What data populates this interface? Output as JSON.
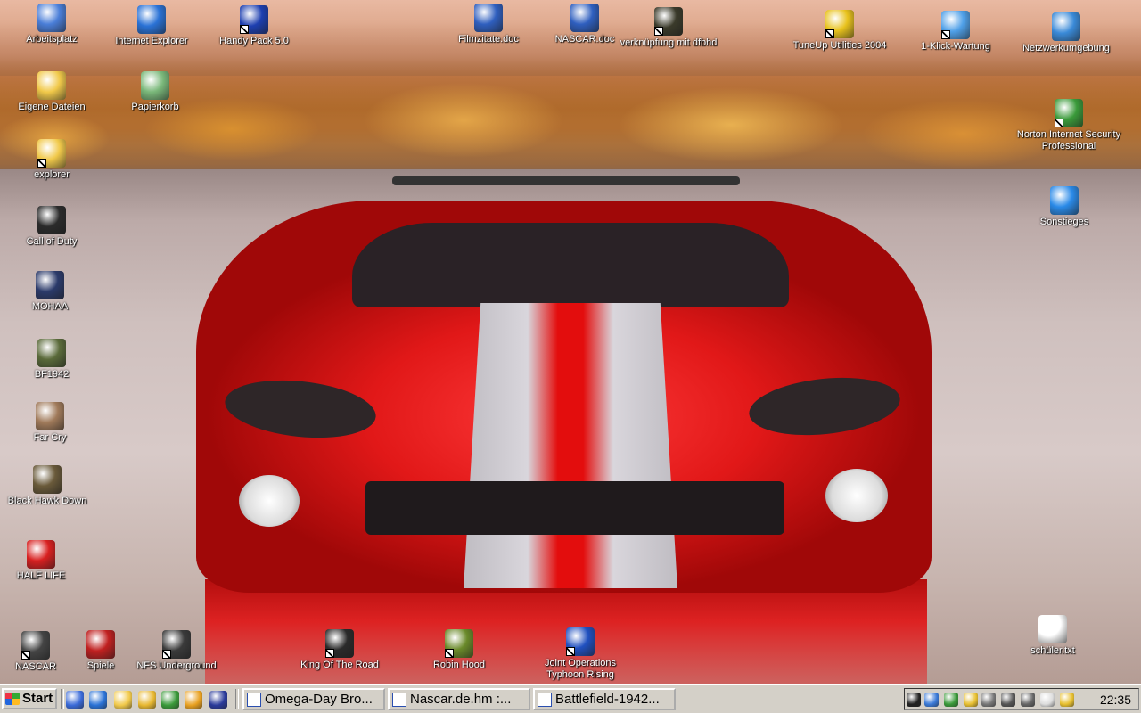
{
  "desktop": {
    "icons": [
      {
        "label": "Arbeitsplatz",
        "icon": "computer-icon",
        "color": "#4a7ed8"
      },
      {
        "label": "Internet Explorer",
        "icon": "internet-explorer-icon",
        "color": "#2a72d6"
      },
      {
        "label": "Handy Pack 5.0",
        "icon": "mobile-phone-icon",
        "color": "#1d3fb0"
      },
      {
        "label": "Filmzitate.doc",
        "icon": "word-document-icon",
        "color": "#2f5fbf"
      },
      {
        "label": "NASCAR.doc",
        "icon": "word-document-icon",
        "color": "#2f5fbf"
      },
      {
        "label": "verknüpfung mit dfbhd",
        "icon": "soldier-icon",
        "color": "#3a3a2a"
      },
      {
        "label": "TuneUp Utilities 2004",
        "icon": "tuneup-icon",
        "color": "#e8c21c"
      },
      {
        "label": "1-Klick-Wartung",
        "icon": "maintenance-icon",
        "color": "#4fa0e8"
      },
      {
        "label": "Netzwerkumgebung",
        "icon": "network-icon",
        "color": "#3a8ad8"
      },
      {
        "label": "Eigene Dateien",
        "icon": "folder-icon",
        "color": "#f1c94a"
      },
      {
        "label": "Papierkorb",
        "icon": "recycle-bin-icon",
        "color": "#7ab87a"
      },
      {
        "label": "Norton Internet Security Professional",
        "icon": "norton-globe-icon",
        "color": "#3a9a3a"
      },
      {
        "label": "explorer",
        "icon": "explorer-folder-icon",
        "color": "#f1c94a"
      },
      {
        "label": "Sonstieges",
        "icon": "butterfly-icon",
        "color": "#2a8ae8"
      },
      {
        "label": "Call of Duty",
        "icon": "call-of-duty-icon",
        "color": "#2b2b2b"
      },
      {
        "label": "MOHAA",
        "icon": "mohaa-emblem-icon",
        "color": "#2b3a6a"
      },
      {
        "label": "BF1942",
        "icon": "battlefield-tank-icon",
        "color": "#5a6a3a"
      },
      {
        "label": "Far Cry",
        "icon": "far-cry-face-icon",
        "color": "#a07a5a"
      },
      {
        "label": "Black Hawk Down",
        "icon": "black-hawk-soldier-icon",
        "color": "#6a5a3a"
      },
      {
        "label": "HALF LIFE",
        "icon": "half-life-lambda-icon",
        "color": "#d82020"
      },
      {
        "label": "NASCAR",
        "icon": "tire-icon",
        "color": "#444444"
      },
      {
        "label": "Spiele",
        "icon": "crest-icon",
        "color": "#c02020"
      },
      {
        "label": "NFS Underground",
        "icon": "wheel-rim-icon",
        "color": "#3a3a3a"
      },
      {
        "label": "King Of The Road",
        "icon": "king-of-the-road-icon",
        "color": "#2a2a2a"
      },
      {
        "label": "Robin Hood",
        "icon": "robin-hood-icon",
        "color": "#6a8a2a"
      },
      {
        "label": "Joint Operations Typhoon Rising",
        "icon": "joint-operations-icon",
        "color": "#2050c0"
      },
      {
        "label": "schüler.txt",
        "icon": "text-file-icon",
        "color": "#ffffff"
      }
    ]
  },
  "taskbar": {
    "start_label": "Start",
    "quick_launch": [
      {
        "icon": "show-desktop-icon",
        "color": "#3a6ad8"
      },
      {
        "icon": "internet-explorer-icon",
        "color": "#2a72d6"
      },
      {
        "icon": "outlook-icon",
        "color": "#f1c94a"
      },
      {
        "icon": "folder-icon",
        "color": "#e8b830"
      },
      {
        "icon": "globe-icon",
        "color": "#3a9a3a"
      },
      {
        "icon": "media-player-icon",
        "color": "#e8a020"
      },
      {
        "icon": "floppy-disk-icon",
        "color": "#2a3a9a"
      }
    ],
    "windows": [
      {
        "label": "Omega-Day Bro..."
      },
      {
        "label": "Nascar.de.hm :..."
      },
      {
        "label": "Battlefield-1942..."
      }
    ],
    "tray": {
      "icons": [
        {
          "icon": "tray-cat-icon",
          "color": "#222222"
        },
        {
          "icon": "tray-network-icon",
          "color": "#3a7ad8"
        },
        {
          "icon": "tray-globe-icon",
          "color": "#3a9a3a"
        },
        {
          "icon": "tray-app-icon",
          "color": "#e8c030"
        },
        {
          "icon": "tray-speaker-icon",
          "color": "#777777"
        },
        {
          "icon": "tray-connection-icon",
          "color": "#555555"
        },
        {
          "icon": "tray-phone-icon",
          "color": "#666666"
        },
        {
          "icon": "tray-cursor-icon",
          "color": "#dddddd"
        },
        {
          "icon": "tray-norton-icon",
          "color": "#e8c030"
        }
      ],
      "clock": "22:35"
    }
  }
}
